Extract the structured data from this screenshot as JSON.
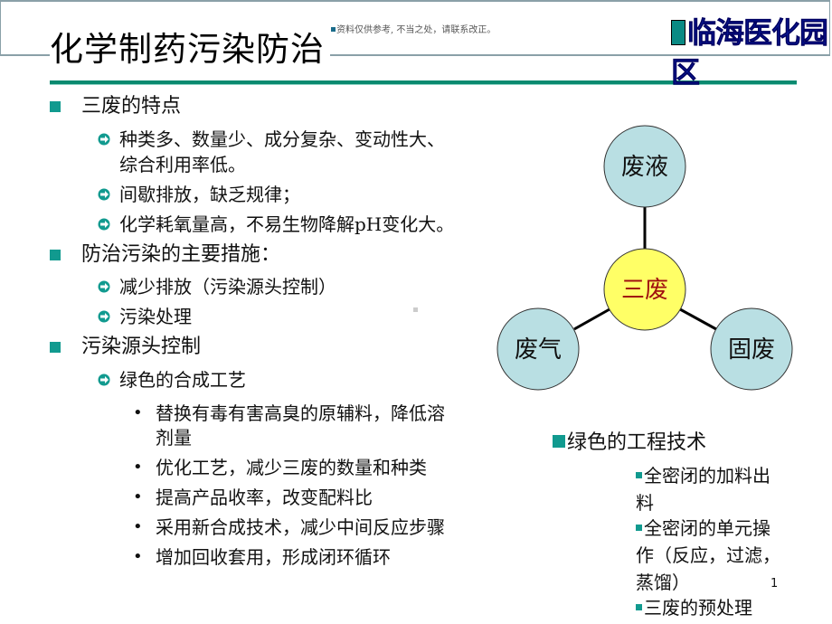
{
  "slide": {
    "title": "化学制药污染防治",
    "watermark": "资料仅供参考, 不当之处，请联系改正。",
    "brand": "临海医化园区",
    "page_number": "1"
  },
  "left": {
    "sections": [
      {
        "heading": "三废的特点",
        "items": [
          {
            "text": "种类多、数量少、成分复杂、变动性大、",
            "cont": "综合利用率低。"
          },
          {
            "text": "间歇排放，缺乏规律；"
          },
          {
            "text": "化学耗氧量高，不易生物降解pH变化大。"
          }
        ]
      },
      {
        "heading": "防治污染的主要措施：",
        "items": [
          {
            "text": "减少排放（污染源头控制）"
          },
          {
            "text": "污染处理"
          }
        ]
      },
      {
        "heading": "污染源头控制",
        "items": [
          {
            "text": "绿色的合成工艺"
          }
        ],
        "subitems": [
          {
            "text": "替换有毒有害高臭的原辅料，降低溶",
            "cont": "剂量"
          },
          {
            "text": "优化工艺，减少三废的数量和种类"
          },
          {
            "text": "提高产品收率，改变配料比"
          },
          {
            "text": "采用新合成技术，减少中间反应步骤"
          },
          {
            "text": "增加回收套用，形成闭环循环"
          }
        ]
      }
    ]
  },
  "diagram": {
    "center": {
      "label": "三废",
      "fill": "#ffff66",
      "text_color": "#a01010"
    },
    "nodes": [
      {
        "label": "废液",
        "fill": "#b9dfe3"
      },
      {
        "label": "废气",
        "fill": "#b9dfe3"
      },
      {
        "label": "固废",
        "fill": "#b9dfe3"
      }
    ]
  },
  "right": {
    "heading": "绿色的工程技术",
    "items": [
      {
        "lines": [
          "全密闭的加料出",
          "料"
        ]
      },
      {
        "lines": [
          "全密闭的单元操",
          "作（反应，过滤，",
          "蒸馏）"
        ]
      },
      {
        "lines": [
          "三废的预处理"
        ]
      }
    ]
  },
  "colors": {
    "accent_teal": "#119a8f",
    "rule_green": "#0a8a70",
    "brand_blue": "#0a1a9a"
  }
}
